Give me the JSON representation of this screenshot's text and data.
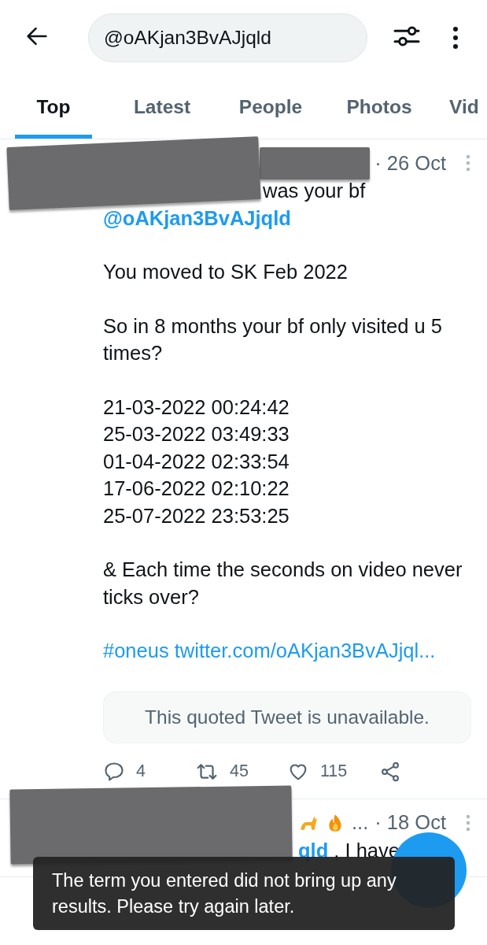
{
  "search": {
    "value": "@oAKjan3BvAJjqld"
  },
  "tabs": [
    {
      "label": "Top",
      "selected": true
    },
    {
      "label": "Latest",
      "selected": false
    },
    {
      "label": "People",
      "selected": false
    },
    {
      "label": "Photos",
      "selected": false
    },
    {
      "label": "Vid",
      "selected": false
    }
  ],
  "tweets": [
    {
      "date": "· 26 Oct",
      "body": [
        {
          "lines": [
            [
              {
                "kind": "continuation",
                "text": "was your bf"
              }
            ],
            [
              {
                "kind": "mention",
                "text": "@oAKjan3BvAJjqld"
              }
            ]
          ]
        },
        {
          "lines": [
            [
              {
                "kind": "text",
                "text": "You moved to SK Feb 2022"
              }
            ]
          ]
        },
        {
          "lines": [
            [
              {
                "kind": "text",
                "text": "So in 8 months your bf only visited u 5 times?"
              }
            ]
          ]
        },
        {
          "lines": [
            [
              {
                "kind": "text",
                "text": "21-03-2022 00:24:42"
              }
            ],
            [
              {
                "kind": "text",
                "text": "25-03-2022 03:49:33"
              }
            ],
            [
              {
                "kind": "text",
                "text": "01-04-2022 02:33:54"
              }
            ],
            [
              {
                "kind": "text",
                "text": "17-06-2022 02:10:22"
              }
            ],
            [
              {
                "kind": "text",
                "text": "25-07-2022 23:53:25"
              }
            ]
          ]
        },
        {
          "lines": [
            [
              {
                "kind": "text",
                "text": "& Each time the seconds on video never ticks over?"
              }
            ]
          ]
        },
        {
          "lines": [
            [
              {
                "kind": "hashtag",
                "text": "#oneus"
              },
              {
                "kind": "link",
                "text": "twitter.com/oAKjan3BvAJjql..."
              }
            ]
          ]
        }
      ],
      "quote": "This quoted Tweet is unavailable.",
      "stats": {
        "replies": "4",
        "retweets": "45",
        "likes": "115"
      }
    },
    {
      "date": "· 18 Oct",
      "header_extra": [
        {
          "kind": "cat"
        },
        {
          "kind": "fire"
        },
        {
          "kind": "text",
          "text": "..."
        }
      ],
      "body": [
        {
          "lines": [
            [
              {
                "kind": "continuation-mention",
                "text": "qld"
              },
              {
                "kind": "text",
                "text": ", I have"
              }
            ]
          ]
        }
      ]
    }
  ],
  "toast": "The term you entered did not bring up any results. Please try again later."
}
